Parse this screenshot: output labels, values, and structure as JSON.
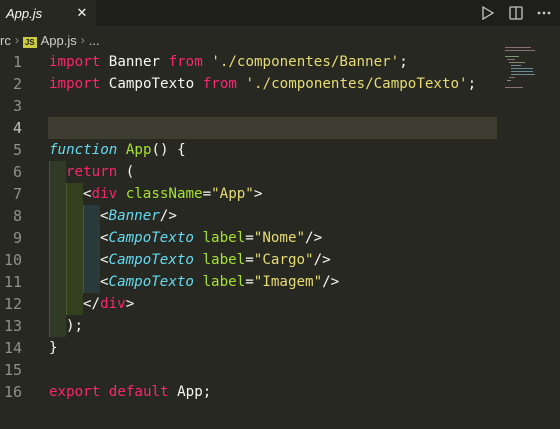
{
  "tab": {
    "title": "App.js",
    "close_icon": "close-icon"
  },
  "actions": {
    "run_icon": "play-icon",
    "split_icon": "split-editor-icon",
    "more_icon": "more-icon"
  },
  "breadcrumb": {
    "segments": [
      "rc",
      "App.js",
      "..."
    ]
  },
  "editor": {
    "active_line": 4,
    "line_numbers": [
      "1",
      "2",
      "3",
      "4",
      "5",
      "6",
      "7",
      "8",
      "9",
      "10",
      "11",
      "12",
      "13",
      "14",
      "15",
      "16"
    ],
    "lines": [
      [
        [
          "kw",
          "import"
        ],
        [
          "",
          "Banner"
        ],
        [
          "kw",
          "from"
        ],
        [
          "str",
          "'./componentes/Banner'"
        ],
        [
          "",
          ";"
        ]
      ],
      [
        [
          "kw",
          "import"
        ],
        [
          "",
          "CampoTexto"
        ],
        [
          "kw",
          "from"
        ],
        [
          "str",
          "'./componentes/CampoTexto'"
        ],
        [
          "",
          ";"
        ]
      ],
      [],
      [],
      [
        [
          "pl it",
          "function"
        ],
        [
          "fn",
          "App"
        ],
        [
          "",
          "()"
        ],
        [
          "",
          "{"
        ]
      ],
      [
        [
          "kw",
          "return"
        ],
        [
          "",
          "("
        ]
      ],
      [
        [
          "",
          "<"
        ],
        [
          "tag",
          "div"
        ],
        [
          "attr",
          "className"
        ],
        [
          "",
          "="
        ],
        [
          "str",
          "\"App\""
        ],
        [
          "",
          ">"
        ]
      ],
      [
        [
          "",
          "<"
        ],
        [
          "comp",
          "Banner"
        ],
        [
          "",
          "/>"
        ]
      ],
      [
        [
          "",
          "<"
        ],
        [
          "comp",
          "CampoTexto"
        ],
        [
          "attr",
          "label"
        ],
        [
          "",
          "="
        ],
        [
          "str",
          "\"Nome\""
        ],
        [
          "",
          "/>"
        ]
      ],
      [
        [
          "",
          "<"
        ],
        [
          "comp",
          "CampoTexto"
        ],
        [
          "attr",
          "label"
        ],
        [
          "",
          "="
        ],
        [
          "str",
          "\"Cargo\""
        ],
        [
          "",
          "/>"
        ]
      ],
      [
        [
          "",
          "<"
        ],
        [
          "comp",
          "CampoTexto"
        ],
        [
          "attr",
          "label"
        ],
        [
          "",
          "="
        ],
        [
          "str",
          "\"Imagem\""
        ],
        [
          "",
          "/>"
        ]
      ],
      [
        [
          "",
          "</"
        ],
        [
          "tag",
          "div"
        ],
        [
          "",
          ">"
        ]
      ],
      [
        [
          "",
          ");"
        ]
      ],
      [
        [
          "",
          "}"
        ]
      ],
      [],
      [
        [
          "kw",
          "export"
        ],
        [
          "kw",
          "default"
        ],
        [
          "",
          "App;"
        ]
      ]
    ]
  },
  "colors": {
    "background": "#272822",
    "keyword": "#f92672",
    "function": "#a6e22e",
    "string": "#e6db74",
    "storage": "#66d9ef",
    "text": "#f8f8f2"
  }
}
